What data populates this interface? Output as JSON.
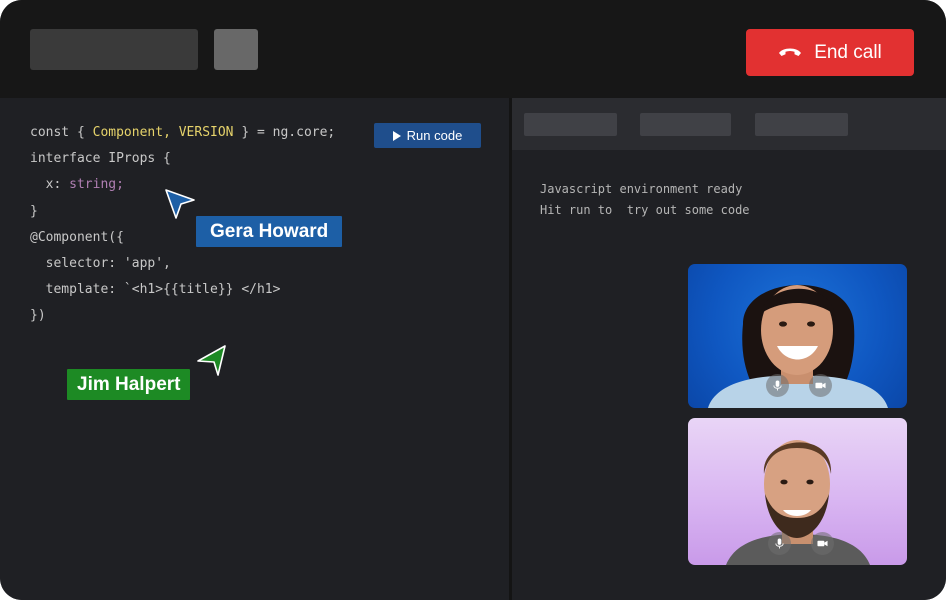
{
  "header": {
    "end_call_label": "End call"
  },
  "editor": {
    "run_label": "Run code",
    "code_lines": [
      [
        {
          "t": "const { ",
          "c": ""
        },
        {
          "t": "Component, VERSION",
          "c": "kw-yellow"
        },
        {
          "t": " } = ng.core;",
          "c": ""
        }
      ],
      [
        {
          "t": "interface IProps {",
          "c": ""
        }
      ],
      [
        {
          "t": "  x: ",
          "c": ""
        },
        {
          "t": "string;",
          "c": "kw-purple"
        }
      ],
      [
        {
          "t": "}",
          "c": ""
        }
      ],
      [
        {
          "t": "@Component({",
          "c": ""
        }
      ],
      [
        {
          "t": "  selector: 'app',",
          "c": ""
        }
      ],
      [
        {
          "t": "  template: `<h1>{{title}} </h1>",
          "c": ""
        }
      ],
      [
        {
          "t": "})",
          "c": ""
        }
      ]
    ]
  },
  "cursors": {
    "gera": {
      "name": "Gera Howard",
      "color": "#1d5fa6"
    },
    "jim": {
      "name": "Jim Halpert",
      "color": "#1d8a24"
    }
  },
  "console": {
    "lines": [
      "Javascript environment ready",
      "Hit run to  try out some code"
    ]
  },
  "participants": [
    {
      "mic_icon": "mic-icon",
      "camera_icon": "video-camera-icon",
      "background": "#0f57c1"
    },
    {
      "mic_icon": "mic-icon",
      "camera_icon": "video-camera-icon",
      "background": "#d9b6f2"
    }
  ],
  "colors": {
    "end_call": "#e23131",
    "run_button": "#1f4e8c"
  }
}
